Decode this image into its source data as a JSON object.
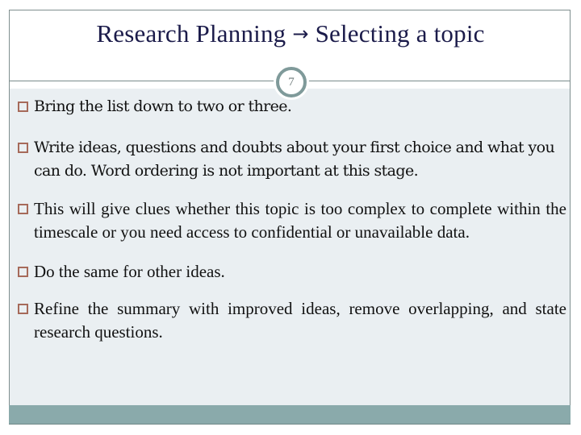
{
  "slide": {
    "title_left": "Research Planning",
    "title_arrow": "→",
    "title_right": "Selecting a topic",
    "page_number": "7",
    "bullet_icon": "square-outline-bullet-icon",
    "colors": {
      "title": "#1b1b4a",
      "bullet_box": "#a66a5a",
      "panel": "#eaeff2",
      "footer_band": "#8aaaab",
      "badge_ring": "#7f9a9a"
    },
    "bullets": [
      {
        "text": "Bring the list down to two or three."
      },
      {
        "text": "Write ideas, questions and doubts about your first choice and what you can do. Word ordering is not important at this stage."
      },
      {
        "text": "This will give clues whether this topic is too complex to complete within the timescale or you need access to confidential or unavailable data."
      },
      {
        "text": "Do the same for other ideas."
      },
      {
        "text": "Refine the summary with improved ideas, remove overlapping, and state research questions."
      }
    ]
  }
}
